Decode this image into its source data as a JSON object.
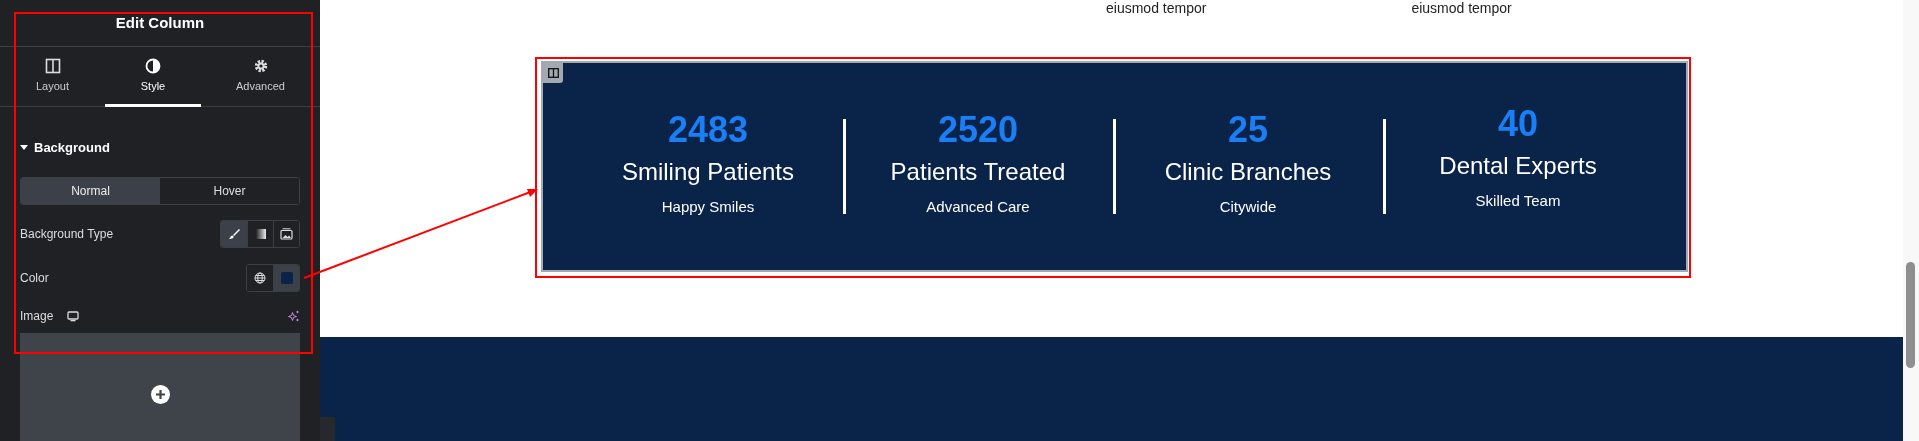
{
  "panel": {
    "title": "Edit Column",
    "tabs": [
      {
        "label": "Layout",
        "selected": false
      },
      {
        "label": "Style",
        "selected": true
      },
      {
        "label": "Advanced",
        "selected": false
      }
    ],
    "section": {
      "title": "Background",
      "expanded": true
    },
    "state_toggle": [
      {
        "label": "Normal",
        "selected": true
      },
      {
        "label": "Hover",
        "selected": false
      }
    ],
    "background_type": {
      "label": "Background Type",
      "options": [
        {
          "selected": true
        },
        {
          "selected": false
        },
        {
          "selected": false
        }
      ]
    },
    "color": {
      "label": "Color",
      "color": "#0a2349"
    },
    "image": {
      "label": "Image"
    }
  },
  "canvas": {
    "top_texts": [
      "eiusmod tempor",
      "eiusmod tempor"
    ],
    "stats": [
      {
        "number": "2483",
        "title": "Smiling Patients",
        "subtitle": "Happy Smiles"
      },
      {
        "number": "2520",
        "title": "Patients Treated",
        "subtitle": "Advanced Care"
      },
      {
        "number": "25",
        "title": "Clinic Branches",
        "subtitle": "Citywide"
      },
      {
        "number": "40",
        "title": "Dental Experts",
        "subtitle": "Skilled Team"
      }
    ]
  }
}
